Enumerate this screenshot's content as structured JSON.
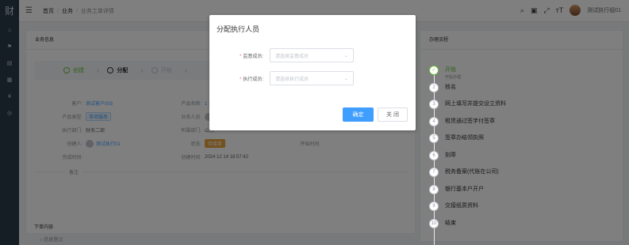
{
  "sidebar": {
    "logo": "财",
    "icons": [
      "home-icon",
      "tag-icon",
      "chart-icon",
      "doc-icon",
      "yen-icon",
      "settings-icon"
    ],
    "icon_glyphs": [
      "⌂",
      "⚑",
      "▤",
      "▦",
      "¥",
      "◎"
    ]
  },
  "header": {
    "breadcrumbs": [
      "首页",
      "业务",
      "业务工单详情"
    ],
    "user_name": "测试执行组01"
  },
  "business_info": {
    "title": "业务信息",
    "steps": [
      {
        "label": "创建",
        "state": "done"
      },
      {
        "label": "分配",
        "state": "active"
      },
      {
        "label": "开始",
        "state": "pending"
      },
      {
        "label": "",
        "state": "pending"
      }
    ],
    "fields": [
      [
        {
          "label": "客户:",
          "value": "测试客户003",
          "type": "link"
        },
        {
          "label": "产品名称:",
          "value": "1 注",
          "type": "link"
        },
        {
          "label": "",
          "value": "",
          "type": "text"
        }
      ],
      [
        {
          "label": "产品类型:",
          "value": "单项服务",
          "type": "tag"
        },
        {
          "label": "业务人员:",
          "value": "",
          "type": "avatar"
        },
        {
          "label": "",
          "value": "",
          "type": "text"
        }
      ],
      [
        {
          "label": "执行部门:",
          "value": "财务二部",
          "type": "text"
        },
        {
          "label": "所属部门:",
          "value": "山东",
          "type": "text"
        },
        {
          "label": "",
          "value": "",
          "type": "text"
        }
      ],
      [
        {
          "label": "创建人:",
          "value": "测试执行01",
          "type": "avatar"
        },
        {
          "label": "状态:",
          "value": "待接单",
          "type": "tag-orange"
        },
        {
          "label": "开始时间:",
          "value": "",
          "type": "text"
        }
      ],
      [
        {
          "label": "完成时间:",
          "value": "",
          "type": "text"
        },
        {
          "label": "创建时间:",
          "value": "2024 12 14 18:57:42",
          "type": "text"
        },
        {
          "label": "",
          "value": "",
          "type": "text"
        }
      ]
    ],
    "remark_label": "备注"
  },
  "sub_content": {
    "title": "下单内容",
    "row": "○  信息登记"
  },
  "process": {
    "title": "办理流程",
    "steps": [
      {
        "num": "✓",
        "label": "开始",
        "sub": "开始办理",
        "done": true
      },
      {
        "num": "2",
        "label": "核名",
        "done": false
      },
      {
        "num": "3",
        "label": "网上填写并提交设立资料",
        "done": false
      },
      {
        "num": "4",
        "label": "租赁通过签字付签章",
        "done": false
      },
      {
        "num": "5",
        "label": "签章办结领执照",
        "done": false
      },
      {
        "num": "6",
        "label": "刻章",
        "done": false
      },
      {
        "num": "7",
        "label": "税务备案(代账在公司)",
        "done": false
      },
      {
        "num": "8",
        "label": "银行基本户开户",
        "done": false
      },
      {
        "num": "9",
        "label": "交接纸质资料",
        "done": false
      },
      {
        "num": "10",
        "label": "结束",
        "done": false
      }
    ]
  },
  "dialog": {
    "title": "分配执行人员",
    "supervisor_label": "监督成员:",
    "supervisor_placeholder": "请选择监督成员",
    "executor_label": "执行成员:",
    "executor_placeholder": "请选择执行成员",
    "confirm_label": "确定",
    "close_label": "关 闭"
  }
}
